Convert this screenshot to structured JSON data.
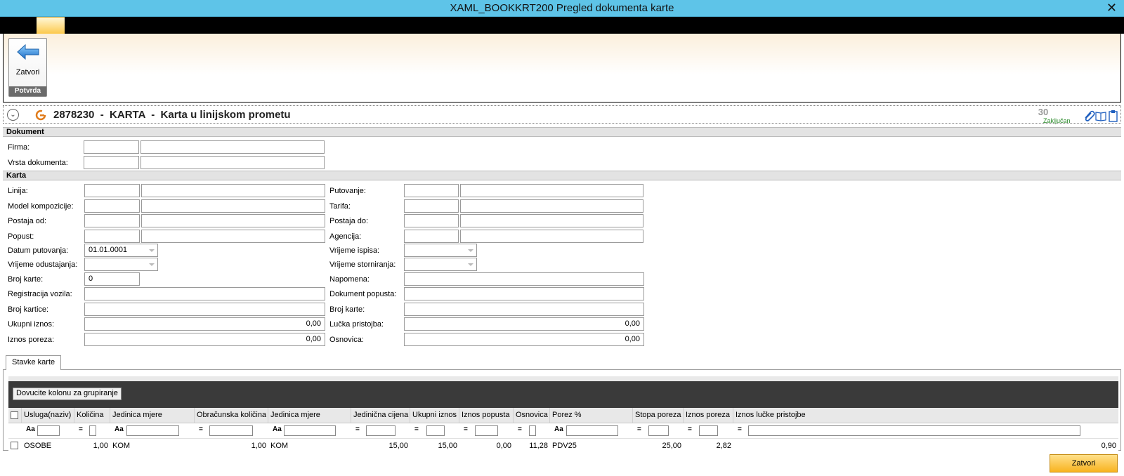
{
  "window": {
    "title": "XAML_BOOKKRT200  Pregled dokumenta karte",
    "close_glyph": "✕"
  },
  "ribbon": {
    "close_label": "Zatvori",
    "group_label": "Potvrda"
  },
  "header": {
    "title": "2878230  -  KARTA  -  Karta u linijskom prometu",
    "status_number": "30",
    "status_label": "Zaključan"
  },
  "sections": {
    "dokument": {
      "title": "Dokument",
      "firma": {
        "label": "Firma:",
        "code": "",
        "name": ""
      },
      "vrsta": {
        "label": "Vrsta dokumenta:",
        "code": "",
        "name": ""
      }
    },
    "karta": {
      "title": "Karta",
      "left": {
        "linija": {
          "label": "Linija:",
          "code": "",
          "name": ""
        },
        "model": {
          "label": "Model kompozicije:",
          "code": "",
          "name": ""
        },
        "postaja_od": {
          "label": "Postaja od:",
          "code": "",
          "name": ""
        },
        "popust": {
          "label": "Popust:",
          "code": "",
          "name": ""
        },
        "datum_putovanja": {
          "label": "Datum putovanja:",
          "value": "01.01.0001"
        },
        "vrijeme_odustajanja": {
          "label": "Vrijeme odustajanja:",
          "value": ""
        },
        "broj_karte": {
          "label": "Broj karte:",
          "value": "0"
        },
        "registracija": {
          "label": "Registracija vozila:",
          "value": ""
        },
        "broj_kartice": {
          "label": "Broj kartice:",
          "value": ""
        },
        "ukupni_iznos": {
          "label": "Ukupni iznos:",
          "value": "0,00"
        },
        "iznos_poreza": {
          "label": "Iznos poreza:",
          "value": "0,00"
        }
      },
      "right": {
        "putovanje": {
          "label": "Putovanje:",
          "code": "",
          "name": ""
        },
        "tarifa": {
          "label": "Tarifa:",
          "code": "",
          "name": ""
        },
        "postaja_do": {
          "label": "Postaja do:",
          "code": "",
          "name": ""
        },
        "agencija": {
          "label": "Agencija:",
          "code": "",
          "name": ""
        },
        "vrijeme_ispisa": {
          "label": "Vrijeme ispisa:",
          "value": ""
        },
        "vrijeme_storniranja": {
          "label": "Vrijeme storniranja:",
          "value": ""
        },
        "napomena": {
          "label": "Napomena:",
          "value": ""
        },
        "dokument_popusta": {
          "label": "Dokument popusta:",
          "value": ""
        },
        "broj_karte": {
          "label": "Broj karte:",
          "value": ""
        },
        "lucka_pristojba": {
          "label": "Lučka pristojba:",
          "value": "0,00"
        },
        "osnovica": {
          "label": "Osnovica:",
          "value": "0,00"
        }
      }
    }
  },
  "tab": {
    "label": "Stavke karte"
  },
  "grid": {
    "group_button": "Dovucite kolonu za grupiranje",
    "columns": [
      "Usluga(naziv)",
      "Količina",
      "Jedinica mjere",
      "Obračunska količina",
      "Jedinica mjere",
      "Jedinična cijena",
      "Ukupni iznos",
      "Iznos popusta",
      "Osnovica",
      "Porez %",
      "Stopa poreza",
      "Iznos poreza",
      "Iznos lučke pristojbe"
    ],
    "filter_ops": {
      "text": "Aa",
      "eq": "="
    },
    "rows": [
      [
        "OSOBE",
        "1,00",
        "KOM",
        "1,00",
        "KOM",
        "15,00",
        "15,00",
        "0,00",
        "11,28",
        "PDV25",
        "25,00",
        "2,82",
        "0,90"
      ]
    ]
  },
  "footer": {
    "close_label": "Zatvori"
  }
}
